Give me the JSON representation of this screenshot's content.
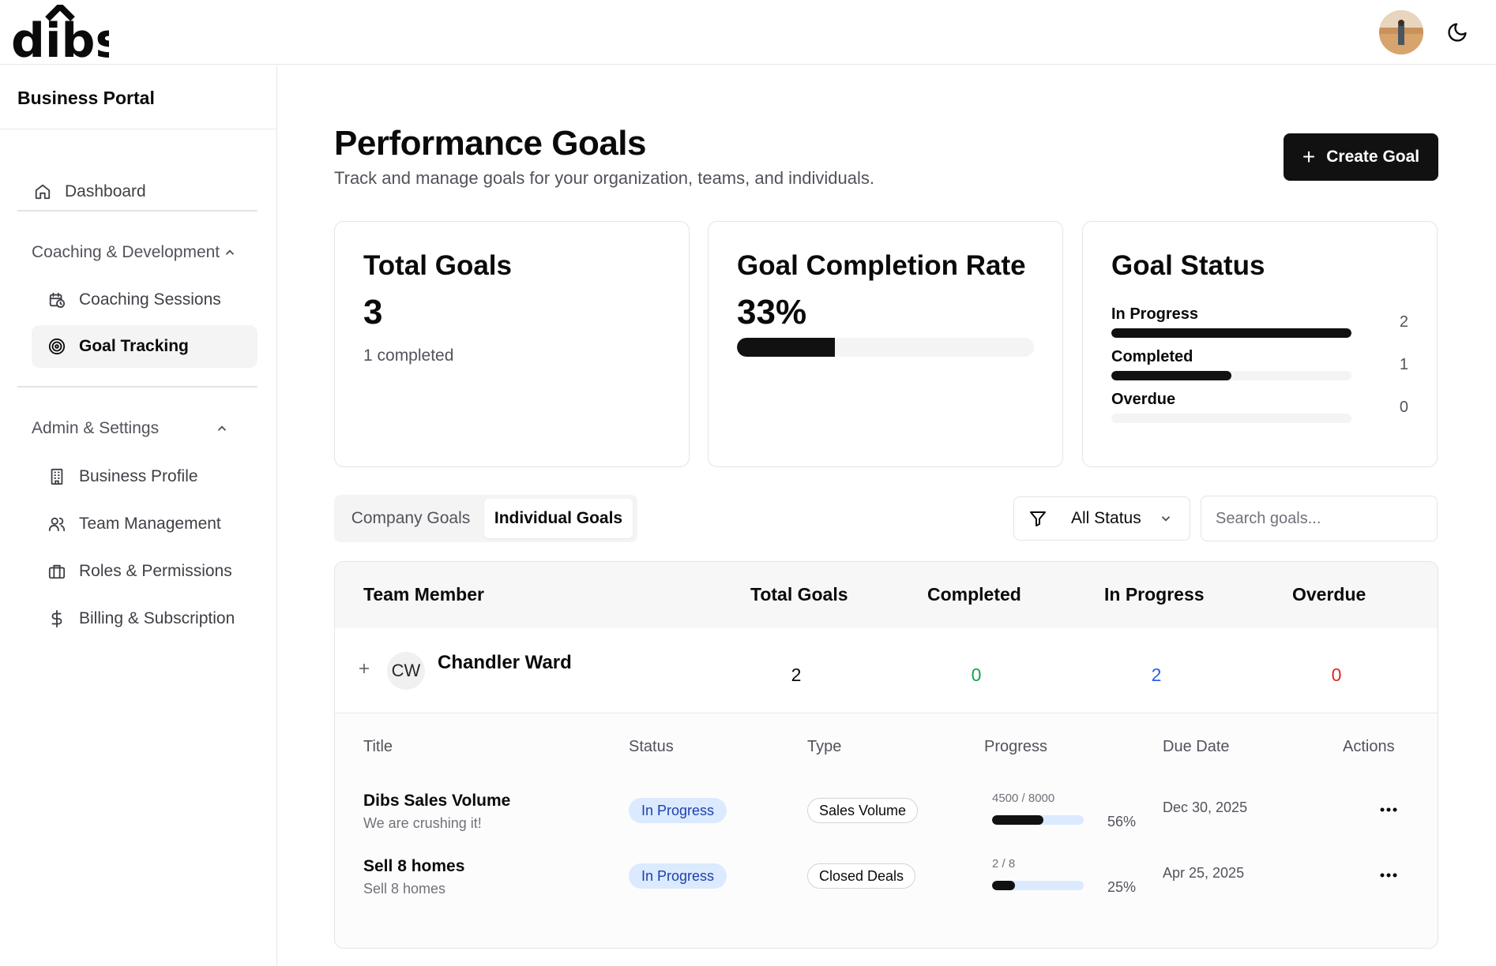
{
  "brand": {
    "logo_text": "dibs"
  },
  "sidebar": {
    "title": "Business Portal",
    "dashboard": {
      "label": "Dashboard",
      "icon": "home-icon"
    },
    "sections": [
      {
        "label": "Coaching & Development",
        "items": [
          {
            "label": "Coaching Sessions",
            "icon": "calendar-clock-icon"
          },
          {
            "label": "Goal Tracking",
            "icon": "target-icon",
            "active": true
          }
        ]
      },
      {
        "label": "Admin & Settings",
        "items": [
          {
            "label": "Business Profile",
            "icon": "building-icon"
          },
          {
            "label": "Team Management",
            "icon": "users-icon"
          },
          {
            "label": "Roles & Permissions",
            "icon": "briefcase-icon"
          },
          {
            "label": "Billing & Subscription",
            "icon": "dollar-icon"
          }
        ]
      }
    ]
  },
  "page": {
    "title": "Performance Goals",
    "subtitle": "Track and manage goals for your organization, teams, and individuals.",
    "create_label": "Create Goal"
  },
  "cards": {
    "total": {
      "title": "Total Goals",
      "value": "3",
      "note": "1 completed"
    },
    "rate": {
      "title": "Goal Completion Rate",
      "value": "33%",
      "fraction": 0.33
    },
    "status": {
      "title": "Goal Status",
      "rows": [
        {
          "label": "In Progress",
          "count": "2",
          "fraction": 1.0
        },
        {
          "label": "Completed",
          "count": "1",
          "fraction": 0.5
        },
        {
          "label": "Overdue",
          "count": "0",
          "fraction": 0.0
        }
      ]
    }
  },
  "tabs": [
    {
      "label": "Company Goals",
      "active": false
    },
    {
      "label": "Individual Goals",
      "active": true
    }
  ],
  "filter": {
    "selected": "All Status"
  },
  "search": {
    "placeholder": "Search goals..."
  },
  "table": {
    "headers": [
      "Team Member",
      "Total Goals",
      "Completed",
      "In Progress",
      "Overdue"
    ],
    "member": {
      "initials": "CW",
      "name": "Chandler Ward",
      "total": "2",
      "completed": "0",
      "in_progress": "2",
      "overdue": "0"
    },
    "colors": {
      "completed": "#16a34a",
      "in_progress": "#2563eb",
      "overdue": "#dc2626"
    },
    "sub_headers": [
      "Title",
      "Status",
      "Type",
      "Progress",
      "Due Date",
      "Actions"
    ],
    "goals": [
      {
        "title": "Dibs Sales Volume",
        "description": "We are crushing it!",
        "status": "In Progress",
        "type": "Sales Volume",
        "progress_text": "4500 / 8000",
        "progress_pct": "56%",
        "fraction": 0.56,
        "due": "Dec 30, 2025"
      },
      {
        "title": "Sell 8 homes",
        "description": "Sell 8 homes",
        "status": "In Progress",
        "type": "Closed Deals",
        "progress_text": "2 / 8",
        "progress_pct": "25%",
        "fraction": 0.25,
        "due": "Apr 25, 2025"
      }
    ]
  }
}
